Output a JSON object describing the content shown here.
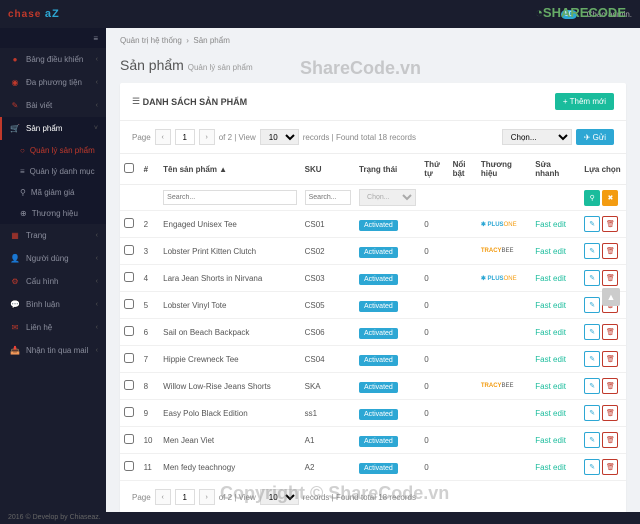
{
  "topbar": {
    "logo_chase": "chase",
    "logo_az": "aZ",
    "notif": "50",
    "greeting": "Chào admin."
  },
  "sharecode": {
    "text": "SHARECODE",
    ".vn": ".vn"
  },
  "sidebar": {
    "items": [
      {
        "icon": "●",
        "label": "Bảng điều khiển"
      },
      {
        "icon": "◉",
        "label": "Đa phương tiện"
      },
      {
        "icon": "✎",
        "label": "Bài viết"
      },
      {
        "icon": "🛒",
        "label": "Sản phẩm",
        "active": true
      },
      {
        "icon": "▦",
        "label": "Trang"
      },
      {
        "icon": "👤",
        "label": "Người dùng"
      },
      {
        "icon": "⚙",
        "label": "Cấu hình"
      },
      {
        "icon": "💬",
        "label": "Bình luận"
      },
      {
        "icon": "✉",
        "label": "Liên hệ"
      },
      {
        "icon": "📥",
        "label": "Nhận tin qua mail"
      }
    ],
    "submenu": [
      {
        "label": "Quản lý sản phẩm",
        "icon": "○",
        "active": true
      },
      {
        "label": "Quản lý danh mục",
        "icon": "≡"
      },
      {
        "label": "Mã giảm giá",
        "icon": "⚲"
      },
      {
        "label": "Thương hiệu",
        "icon": "⊕"
      }
    ]
  },
  "breadcrumb": {
    "a": "Quản trị hệ thống",
    "b": "Sản phẩm"
  },
  "page": {
    "title": "Sản phẩm",
    "sub": "Quản lý sản phẩm"
  },
  "panel": {
    "title": "DANH SÁCH SẢN PHẨM",
    "add": "+ Thêm mới"
  },
  "pager": {
    "page_label": "Page",
    "page": "1",
    "of": "of 2 | View",
    "view": "10",
    "records": "records | Found total 18 records",
    "choose": "Chọn...",
    "send": "✈ Gửi"
  },
  "cols": {
    "chk": "",
    "num": "#",
    "name": "Tên sản phẩm",
    "sku": "SKU",
    "status": "Trạng thái",
    "order": "Thứ tự",
    "featured": "Nổi bật",
    "brand": "Thương hiệu",
    "fastedit": "Sửa nhanh",
    "options": "Lựa chọn"
  },
  "filters": {
    "search": "Search...",
    "choose": "Chọn..."
  },
  "fastedit": "Fast edit",
  "status_label": "Activated",
  "rows": [
    {
      "n": "2",
      "name": "Engaged Unisex Tee",
      "sku": "CS01",
      "order": "0",
      "brand": "plus"
    },
    {
      "n": "3",
      "name": "Lobster Print Kitten Clutch",
      "sku": "CS02",
      "order": "0",
      "brand": "tracy"
    },
    {
      "n": "4",
      "name": "Lara Jean Shorts in Nirvana",
      "sku": "CS03",
      "order": "0",
      "brand": "plus"
    },
    {
      "n": "5",
      "name": "Lobster Vinyl Tote",
      "sku": "CS05",
      "order": "0",
      "brand": ""
    },
    {
      "n": "6",
      "name": "Sail on Beach Backpack",
      "sku": "CS06",
      "order": "0",
      "brand": ""
    },
    {
      "n": "7",
      "name": "Hippie Crewneck Tee",
      "sku": "CS04",
      "order": "0",
      "brand": ""
    },
    {
      "n": "8",
      "name": "Willow Low-Rise Jeans Shorts",
      "sku": "SKA",
      "order": "0",
      "brand": "tracy"
    },
    {
      "n": "9",
      "name": "Easy Polo Black Edition",
      "sku": "ss1",
      "order": "0",
      "brand": ""
    },
    {
      "n": "10",
      "name": "Men Jean Viet",
      "sku": "A1",
      "order": "0",
      "brand": ""
    },
    {
      "n": "11",
      "name": "Men fedy teachnogy",
      "sku": "A2",
      "order": "0",
      "brand": ""
    }
  ],
  "footer": "2016 © Develop by Chiaseaz.",
  "watermarks": {
    "wm1": "ShareCode.vn",
    "wm2": "Copyright © ShareCode.vn"
  }
}
